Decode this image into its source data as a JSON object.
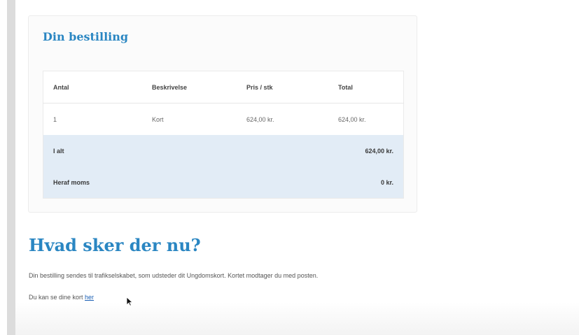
{
  "order": {
    "title": "Din bestilling",
    "columns": [
      "Antal",
      "Beskrivelse",
      "Pris / stk",
      "Total"
    ],
    "rows": [
      [
        "1",
        "Kort",
        "624,00 kr.",
        "624,00 kr."
      ]
    ],
    "total_label": "I alt",
    "total_value": "624,00 kr.",
    "vat_label": "Heraf moms",
    "vat_value": "0 kr."
  },
  "next_steps": {
    "heading": "Hvad sker der nu?",
    "body": "Din bestilling sendes til trafikselskabet, som udsteder dit Ungdomskort. Kortet modtager du med posten.",
    "link_prefix": "Du kan se dine kort ",
    "link_text": "her"
  },
  "colors": {
    "accent": "#2a86c2",
    "summary_bg": "#e2ecf6",
    "link": "#1a5fb4"
  }
}
